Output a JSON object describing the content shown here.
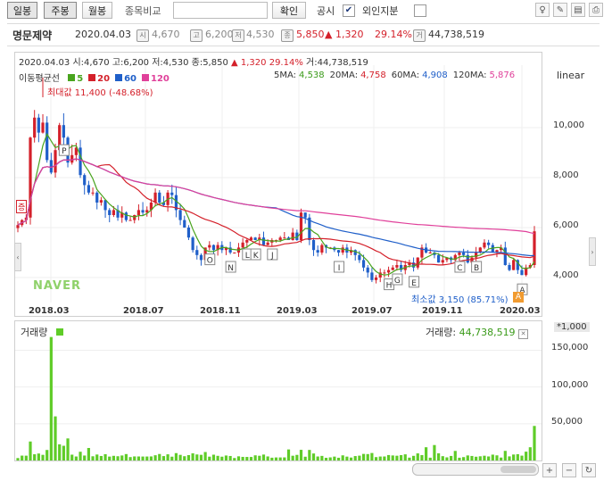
{
  "toolbar": {
    "daily": "일봉",
    "weekly": "주봉",
    "monthly": "월봉",
    "compare_label": "종목비교",
    "compare_value": "",
    "confirm": "확인",
    "disclosure": "공시",
    "foreign": "외인지분",
    "disclosure_checked": true,
    "foreign_checked": false
  },
  "stock": {
    "name": "명문제약",
    "date": "2020.04.03",
    "open_icon": "시",
    "open": "4,670",
    "high_icon": "고",
    "high": "6,200",
    "low_icon": "저",
    "low": "4,530",
    "close_icon": "종",
    "close": "5,850",
    "change": "▲ 1,320",
    "change_pct": "29.14%",
    "volume_icon": "거",
    "volume": "44,738,519"
  },
  "chart": {
    "ohlc_line": {
      "date": "2020.04.03",
      "open": "시:4,670",
      "high": "고:6,200",
      "low": "저:4,530",
      "close": "종:5,850",
      "change": "▲ 1,320",
      "pct": "29.14%",
      "vol": "거:44,738,519"
    },
    "ma_label": "이동평균선",
    "ma_legend": [
      {
        "label": "5",
        "color": "#49a41e"
      },
      {
        "label": "20",
        "color": "#d4202a"
      },
      {
        "label": "60",
        "color": "#1f5fc9"
      },
      {
        "label": "120",
        "color": "#e0409a"
      }
    ],
    "ma_values": [
      {
        "label": "5MA:",
        "value": "4,538",
        "color": "#3a9a19"
      },
      {
        "label": "20MA:",
        "value": "4,758",
        "color": "#d4202a"
      },
      {
        "label": "60MA:",
        "value": "4,908",
        "color": "#1f5fc9"
      },
      {
        "label": "120MA:",
        "value": "5,876",
        "color": "#e0409a"
      }
    ],
    "scale": "linear",
    "max_label": "최대값 11,400 (-48.68%)",
    "min_label": "최소값 3,150 (85.71%)",
    "watermark": "NAVER",
    "y_ticks": [
      "10,000",
      "8,000",
      "6,000",
      "4,000"
    ],
    "x_ticks": [
      "2018.03",
      "2018.07",
      "2018.11",
      "2019.03",
      "2019.07",
      "2019.11",
      "2020.03"
    ],
    "markers": [
      "P",
      "O",
      "N",
      "L",
      "K",
      "J",
      "I",
      "H",
      "G",
      "E",
      "C",
      "B",
      "A"
    ],
    "left_badge": "증",
    "colors": {
      "up": "#d4202a",
      "down": "#1f5fc9",
      "ma5": "#49a41e",
      "ma20": "#d4202a",
      "ma60": "#1f5fc9",
      "ma120": "#e0409a"
    }
  },
  "volume": {
    "label": "거래량",
    "value_label": "거래량:",
    "value": "44,738,519",
    "unit": "*1,000",
    "y_ticks": [
      "150,000",
      "100,000",
      "50,000"
    ],
    "bar_color": "#5fcc28"
  },
  "chart_data": {
    "type": "candlestick",
    "interval": "weekly",
    "y_range": [
      3000,
      12500
    ],
    "price_series": [
      {
        "name": "close",
        "values": [
          6100,
          6300,
          6400,
          9600,
          10400,
          9800,
          10200,
          8700,
          8200,
          9100,
          10100,
          9600,
          8600,
          8900,
          9200,
          8100,
          7700,
          7400,
          7400,
          7000,
          7100,
          6700,
          6500,
          6700,
          6400,
          6600,
          6300,
          6300,
          6500,
          6700,
          6600,
          6700,
          7000,
          7400,
          7000,
          6900,
          7400,
          7300,
          6700,
          6300,
          6000,
          5600,
          5100,
          4900,
          4700,
          5200,
          5300,
          5100,
          5300,
          5100,
          5200,
          5000,
          5000,
          5200,
          5400,
          5500,
          5600,
          5500,
          5600,
          5300,
          5400,
          5500,
          5500,
          5600,
          5600,
          5500,
          5800,
          5500,
          6600,
          6400,
          5500,
          5100,
          5000,
          5300,
          5200,
          5200,
          5100,
          5000,
          5200,
          5000,
          5100,
          4900,
          4700,
          4400,
          4200,
          3900,
          4000,
          4200,
          4200,
          4300,
          4400,
          4500,
          4300,
          4500,
          4600,
          4400,
          4800,
          5200,
          5000,
          5000,
          4900,
          4600,
          4700,
          4800,
          4700,
          4900,
          5000,
          4900,
          4600,
          4800,
          5000,
          5200,
          5400,
          5300,
          5000,
          5100,
          5200,
          4500,
          4300,
          4700,
          4300,
          4100,
          4400,
          4500,
          5850
        ]
      }
    ],
    "volume_series": {
      "name": "거래량",
      "unit": "*1,000"
    }
  }
}
